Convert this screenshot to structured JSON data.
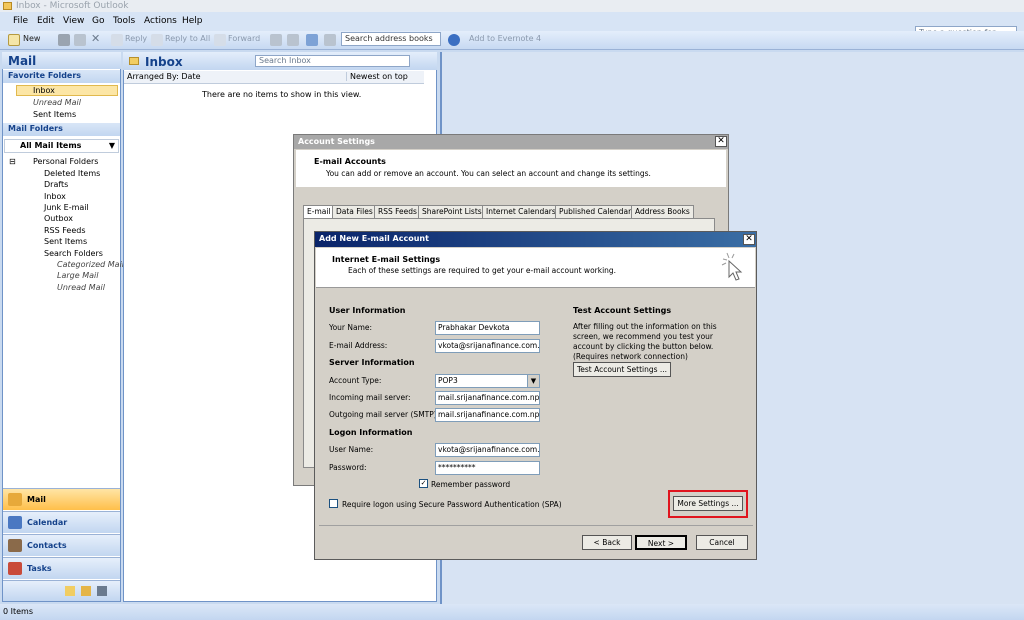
{
  "window": {
    "title": "Inbox - Microsoft Outlook"
  },
  "menu": {
    "items": [
      "File",
      "Edit",
      "View",
      "Go",
      "Tools",
      "Actions",
      "Help"
    ],
    "help_placeholder": "Type a question for help"
  },
  "toolbar": {
    "new": "New",
    "reply": "Reply",
    "reply_all": "Reply to All",
    "forward": "Forward",
    "search_books": "Search address books",
    "evernote": "Add to Evernote 4"
  },
  "nav": {
    "title": "Mail",
    "favorites_header": "Favorite Folders",
    "favorites": [
      "Inbox",
      "Unread Mail",
      "Sent Items"
    ],
    "mail_folders_header": "Mail Folders",
    "all_mail": "All Mail Items",
    "personal_folders": "Personal Folders",
    "folders": [
      "Deleted Items",
      "Drafts",
      "Inbox",
      "Junk E-mail",
      "Outbox",
      "RSS Feeds",
      "Sent Items",
      "Search Folders"
    ],
    "search_folders": [
      "Categorized Mail",
      "Large Mail",
      "Unread Mail"
    ],
    "buttons": [
      "Mail",
      "Calendar",
      "Contacts",
      "Tasks"
    ]
  },
  "inbox": {
    "title": "Inbox",
    "search_placeholder": "Search Inbox",
    "arranged_by": "Arranged By: Date",
    "sort": "Newest on top",
    "empty_message": "There are no items to show in this view."
  },
  "status": {
    "items": "0 Items"
  },
  "account_settings": {
    "title": "Account Settings",
    "header_title": "E-mail Accounts",
    "header_desc": "You can add or remove an account. You can select an account and change its settings.",
    "tabs": [
      "E-mail",
      "Data Files",
      "RSS Feeds",
      "SharePoint Lists",
      "Internet Calendars",
      "Published Calendars",
      "Address Books"
    ]
  },
  "add_account": {
    "title": "Add New E-mail Account",
    "header_title": "Internet E-mail Settings",
    "header_desc": "Each of these settings are required to get your e-mail account working.",
    "user_info": "User Information",
    "your_name_label": "Your Name:",
    "your_name": "Prabhakar Devkota",
    "email_label": "E-mail Address:",
    "email": "vkota@srijanafinance.com.np",
    "server_info": "Server Information",
    "account_type_label": "Account Type:",
    "account_type": "POP3",
    "incoming_label": "Incoming mail server:",
    "incoming": "mail.srijanafinance.com.np",
    "outgoing_label": "Outgoing mail server (SMTP):",
    "outgoing": "mail.srijanafinance.com.np",
    "logon_info": "Logon Information",
    "username_label": "User Name:",
    "username": "vkota@srijanafinance.com.np",
    "password_label": "Password:",
    "password": "**********",
    "remember_password": "Remember password",
    "spa": "Require logon using Secure Password Authentication (SPA)",
    "test_title": "Test Account Settings",
    "test_desc": "After filling out the information on this screen, we recommend you test your account by clicking the button below. (Requires network connection)",
    "test_button": "Test Account Settings ...",
    "more_settings": "More Settings ...",
    "back": "< Back",
    "next": "Next >",
    "cancel": "Cancel"
  },
  "colors": {
    "accent": "#15428b",
    "selected_nav": "#ffbf4a",
    "highlight": "#e0141e"
  }
}
